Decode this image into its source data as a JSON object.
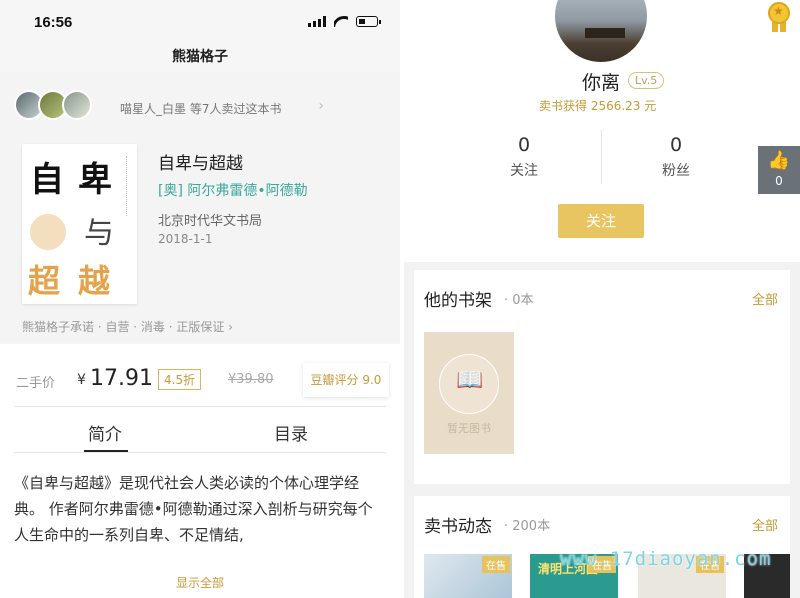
{
  "status": {
    "time": "16:56"
  },
  "left": {
    "nav_title": "熊猫格子",
    "sellers_text": "喵星人_白墨 等7人卖过这本书",
    "cover": {
      "char1": "自",
      "char2": "卑",
      "char3": "与",
      "char4": "超",
      "char5": "越"
    },
    "book": {
      "title": "自卑与超越",
      "author": "[奥] 阿尔弗雷德•阿德勒",
      "publisher": "北京时代华文书局",
      "date": "2018-1-1"
    },
    "promise": "熊猫格子承诺 · 自营 · 消毒 · 正版保证 ›",
    "price": {
      "label": "二手价",
      "currency": "¥",
      "value": "17.91",
      "discount": "4.5折",
      "original": "¥39.80",
      "douban": "豆瓣评分 9.0"
    },
    "tabs": [
      "简介",
      "目录"
    ],
    "intro": "《自卑与超越》是现代社会人类必读的个体心理学经典。 作者阿尔弗雷德•阿德勒通过深入剖析与研究每个人生命中的一系列自卑、不足情结,",
    "show_all": "显示全部"
  },
  "right": {
    "username": "你离",
    "level": "Lv.5",
    "earned": "卖书获得 2566.23 元",
    "following": {
      "count": "0",
      "label": "关注"
    },
    "followers": {
      "count": "0",
      "label": "粉丝"
    },
    "likes": "0",
    "follow_button": "关注",
    "shelf": {
      "title": "他的书架",
      "count": "· 0本",
      "all": "全部",
      "empty": "暂无图书"
    },
    "sales": {
      "title": "卖书动态",
      "count": "· 200本",
      "all": "全部",
      "tag": "在售",
      "book2_title": "清明上河图"
    }
  },
  "watermark": "www.17diaoyan.com",
  "colors": {
    "accent": "#c59a38",
    "button": "#e9c561",
    "author": "#3aa89a"
  }
}
